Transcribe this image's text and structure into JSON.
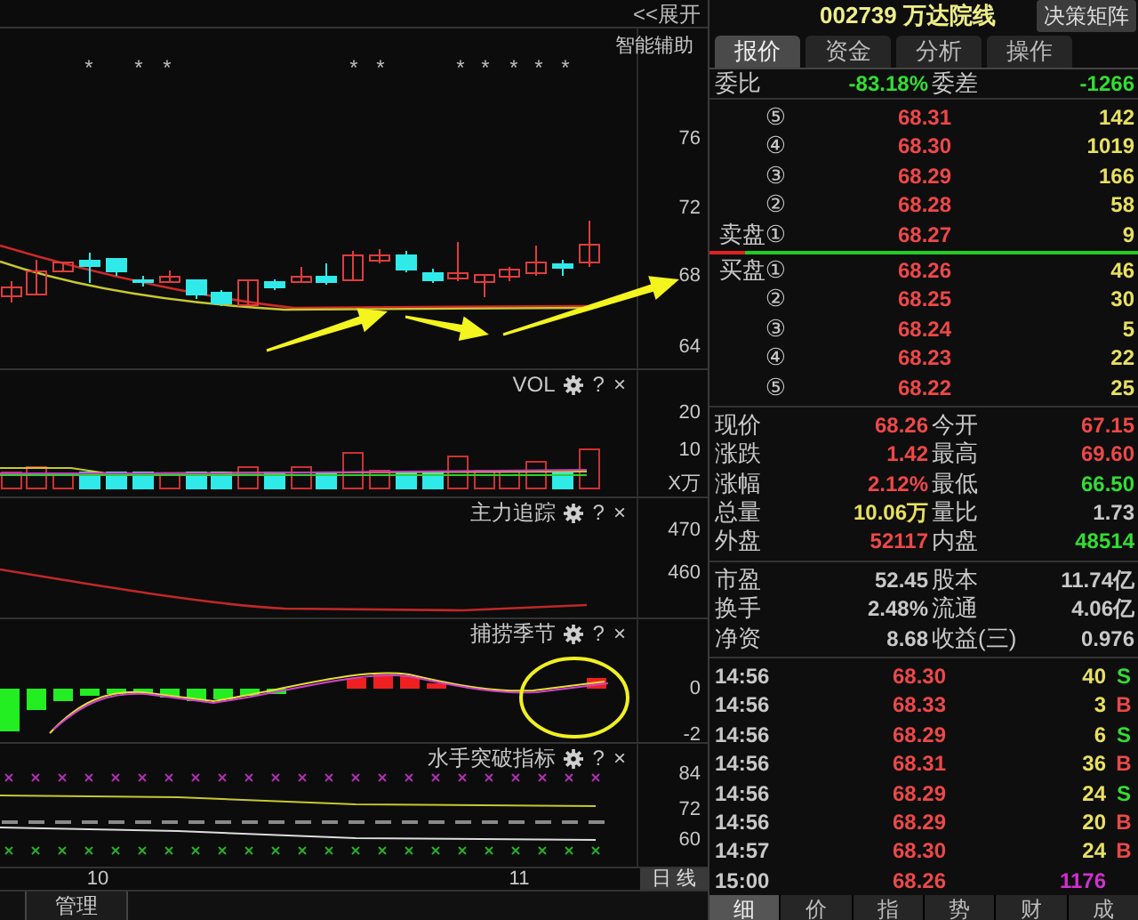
{
  "chart": {
    "expand_button": "<<展开",
    "panels": [
      {
        "kind": "candles",
        "title": "智能辅助",
        "signal_marks": [
          "*",
          "*",
          "*",
          "*",
          "*",
          "*",
          "*",
          "*",
          "*",
          "*"
        ],
        "axis_labels": [
          "76",
          "72",
          "68",
          "64"
        ]
      },
      {
        "kind": "volume",
        "title": "VOL",
        "help": "?",
        "close": "×",
        "axis_labels": [
          "20",
          "10",
          "X万"
        ]
      },
      {
        "kind": "line",
        "title": "主力追踪",
        "help": "?",
        "close": "×",
        "axis_labels": [
          "470",
          "460"
        ]
      },
      {
        "kind": "histogram",
        "title": "捕捞季节",
        "help": "?",
        "close": "×",
        "axis_labels": [
          "0",
          "-2"
        ]
      },
      {
        "kind": "bands",
        "title": "水手突破指标",
        "help": "?",
        "close": "×",
        "axis_labels": [
          "84",
          "72",
          "60"
        ]
      }
    ],
    "x_labels": [
      "10",
      "11"
    ],
    "period_button": "日 线",
    "bottom_tab": "管理"
  },
  "quote": {
    "code": "002739",
    "name": "万达院线",
    "matrix_button": "决策矩阵",
    "tabs": [
      {
        "label": "报价",
        "selected": true
      },
      {
        "label": "资金",
        "selected": false
      },
      {
        "label": "分析",
        "selected": false
      },
      {
        "label": "操作",
        "selected": false
      }
    ],
    "ratio": {
      "label": "委比",
      "value": "-83.18%",
      "label_2": "委差",
      "value_2": "-1266"
    },
    "asks": [
      {
        "label": "⑤",
        "price": "68.31",
        "volume": "142"
      },
      {
        "label": "④",
        "price": "68.30",
        "volume": "1019"
      },
      {
        "label": "③",
        "price": "68.29",
        "volume": "166"
      },
      {
        "label": "②",
        "price": "68.28",
        "volume": "58"
      },
      {
        "label": "卖盘①",
        "price": "68.27",
        "volume": "9"
      }
    ],
    "bids": [
      {
        "label": "买盘①",
        "price": "68.26",
        "volume": "46"
      },
      {
        "label": "②",
        "price": "68.25",
        "volume": "30"
      },
      {
        "label": "③",
        "price": "68.24",
        "volume": "5"
      },
      {
        "label": "④",
        "price": "68.23",
        "volume": "22"
      },
      {
        "label": "⑤",
        "price": "68.22",
        "volume": "25"
      }
    ],
    "stats": [
      {
        "label": "现价",
        "value": "68.26",
        "color": "#ee4848"
      },
      {
        "label": "今开",
        "value": "67.15",
        "color": "#ee4848"
      },
      {
        "label": "涨跌",
        "value": "1.42",
        "color": "#ee4848"
      },
      {
        "label": "最高",
        "value": "69.60",
        "color": "#ee4848"
      },
      {
        "label": "涨幅",
        "value": "2.12%",
        "color": "#ee4848"
      },
      {
        "label": "最低",
        "value": "66.50",
        "color": "#33dd33"
      },
      {
        "label": "总量",
        "value": "10.06万",
        "color": "#e8e060"
      },
      {
        "label": "量比",
        "value": "1.73",
        "color": "#c8c8c8"
      },
      {
        "label": "外盘",
        "value": "52117",
        "color": "#ee4848"
      },
      {
        "label": "内盘",
        "value": "48514",
        "color": "#33dd33"
      }
    ],
    "finance": [
      {
        "label": "市盈",
        "value": "52.45"
      },
      {
        "label": "股本",
        "value": "11.74亿"
      },
      {
        "label": "换手",
        "value": "2.48%"
      },
      {
        "label": "流通",
        "value": "4.06亿"
      },
      {
        "label": "净资",
        "value": "8.68"
      },
      {
        "label": "收益(三)",
        "value": "0.976"
      }
    ],
    "ticks": [
      {
        "kind": "trade",
        "time": "14:56",
        "price": "68.30",
        "volume": "40",
        "side": "S",
        "color": "#33dd33"
      },
      {
        "kind": "trade",
        "time": "14:56",
        "price": "68.33",
        "volume": "3",
        "side": "B",
        "color": "#ee4848"
      },
      {
        "kind": "trade",
        "time": "14:56",
        "price": "68.29",
        "volume": "6",
        "side": "S",
        "color": "#33dd33"
      },
      {
        "kind": "trade",
        "time": "14:56",
        "price": "68.31",
        "volume": "36",
        "side": "B",
        "color": "#ee4848"
      },
      {
        "kind": "trade",
        "time": "14:56",
        "price": "68.29",
        "volume": "24",
        "side": "S",
        "color": "#33dd33"
      },
      {
        "kind": "trade",
        "time": "14:56",
        "price": "68.29",
        "volume": "20",
        "side": "B",
        "color": "#ee4848"
      },
      {
        "kind": "trade",
        "time": "14:57",
        "price": "68.30",
        "volume": "24",
        "side": "B",
        "color": "#ee4848"
      },
      {
        "kind": "close",
        "time": "15:00",
        "price": "68.26",
        "volume": "1176"
      }
    ],
    "bottom_tabs": [
      {
        "label": "细",
        "selected": true
      },
      {
        "label": "价",
        "selected": false
      },
      {
        "label": "指",
        "selected": false
      },
      {
        "label": "势",
        "selected": false
      },
      {
        "label": "财",
        "selected": false
      },
      {
        "label": "成",
        "selected": false
      }
    ]
  }
}
